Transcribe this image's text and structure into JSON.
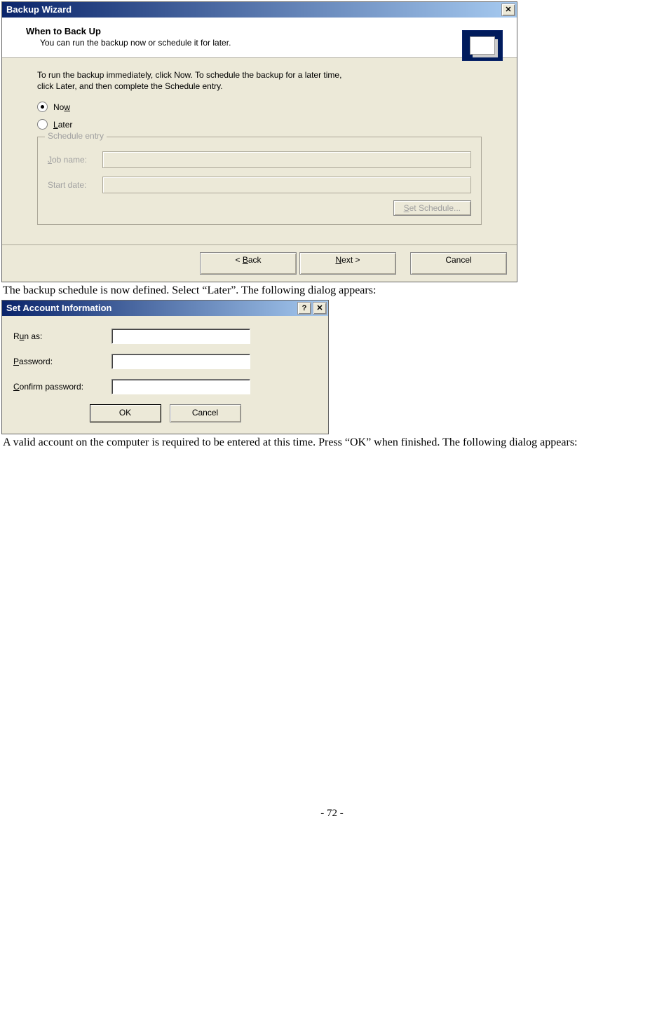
{
  "wizard": {
    "title": "Backup Wizard",
    "header_title": "When to Back Up",
    "header_subtitle": "You can run the backup now or schedule it for later.",
    "instructions": "To run the backup immediately, click Now. To schedule the backup for a later time, click Later, and then complete the Schedule entry.",
    "radio_now_prefix": "No",
    "radio_now_u": "w",
    "radio_later_u": "L",
    "radio_later_suffix": "ater",
    "fieldset_legend": "Schedule entry",
    "job_name_prefix": "",
    "job_name_u": "J",
    "job_name_suffix": "ob name:",
    "start_date_label": "Start date:",
    "set_schedule_u": "S",
    "set_schedule_suffix": "et Schedule...",
    "back_lt": "< ",
    "back_u": "B",
    "back_suffix": "ack",
    "next_u": "N",
    "next_suffix": "ext >",
    "cancel": "Cancel"
  },
  "doc_text_1": "The backup schedule is now defined.  Select “Later”.  The following dialog appears:",
  "account": {
    "title": "Set Account Information",
    "run_as_prefix": "R",
    "run_as_u": "u",
    "run_as_suffix": "n as:",
    "password_u": "P",
    "password_suffix": "assword:",
    "confirm_u": "C",
    "confirm_suffix": "onfirm password:",
    "ok": "OK",
    "cancel": "Cancel"
  },
  "doc_text_2": "A valid account on the computer is required to be entered at this time.  Press “OK” when finished.  The following dialog appears:",
  "page_num": "- 72 -"
}
